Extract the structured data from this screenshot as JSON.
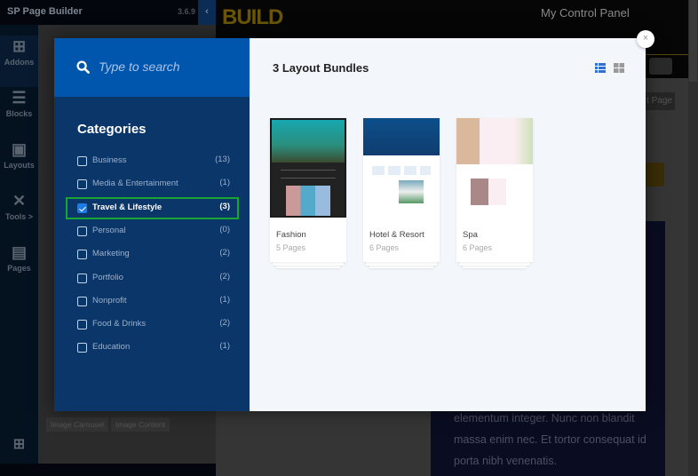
{
  "background": {
    "app_title": "SP Page Builder",
    "version": "3.6.9",
    "sidebar": [
      {
        "label": "Addons",
        "icon": "add-file-icon"
      },
      {
        "label": "Blocks",
        "icon": "blocks-icon"
      },
      {
        "label": "Layouts",
        "icon": "layouts-icon"
      },
      {
        "label": "Tools >",
        "icon": "tools-icon"
      },
      {
        "label": "Pages",
        "icon": "pages-icon"
      }
    ],
    "addon_buttons": [
      "Image Carousel",
      "Image Content"
    ],
    "site_logo": "BUILD in STORE",
    "control_panel": "My Control Panel",
    "page_button": "t Page",
    "body_text": "elementum integer. Nunc non blandit massa enim nec. Et tortor consequat id porta nibh venenatis."
  },
  "modal": {
    "search_placeholder": "Type to search",
    "categories_title": "Categories",
    "categories": [
      {
        "label": "Business",
        "count": "(13)",
        "checked": false
      },
      {
        "label": "Media & Entertainment",
        "count": "(1)",
        "checked": false
      },
      {
        "label": "Travel & Lifestyle",
        "count": "(3)",
        "checked": true
      },
      {
        "label": "Personal",
        "count": "(0)",
        "checked": false
      },
      {
        "label": "Marketing",
        "count": "(2)",
        "checked": false
      },
      {
        "label": "Portfolio",
        "count": "(2)",
        "checked": false
      },
      {
        "label": "Nonprofit",
        "count": "(1)",
        "checked": false
      },
      {
        "label": "Food & Drinks",
        "count": "(2)",
        "checked": false
      },
      {
        "label": "Education",
        "count": "(1)",
        "checked": false
      }
    ],
    "bundles_title": "3 Layout Bundles",
    "view_mode": "list",
    "bundles": [
      {
        "name": "Fashion",
        "pages": "5 Pages"
      },
      {
        "name": "Hotel & Resort",
        "pages": "6 Pages"
      },
      {
        "name": "Spa",
        "pages": "6 Pages"
      }
    ],
    "close_label": "×",
    "colors": {
      "search_bg": "#0055ad",
      "sidebar_bg": "#0b3669",
      "selected_border": "#17a534",
      "accent": "#1e7ae6"
    }
  }
}
